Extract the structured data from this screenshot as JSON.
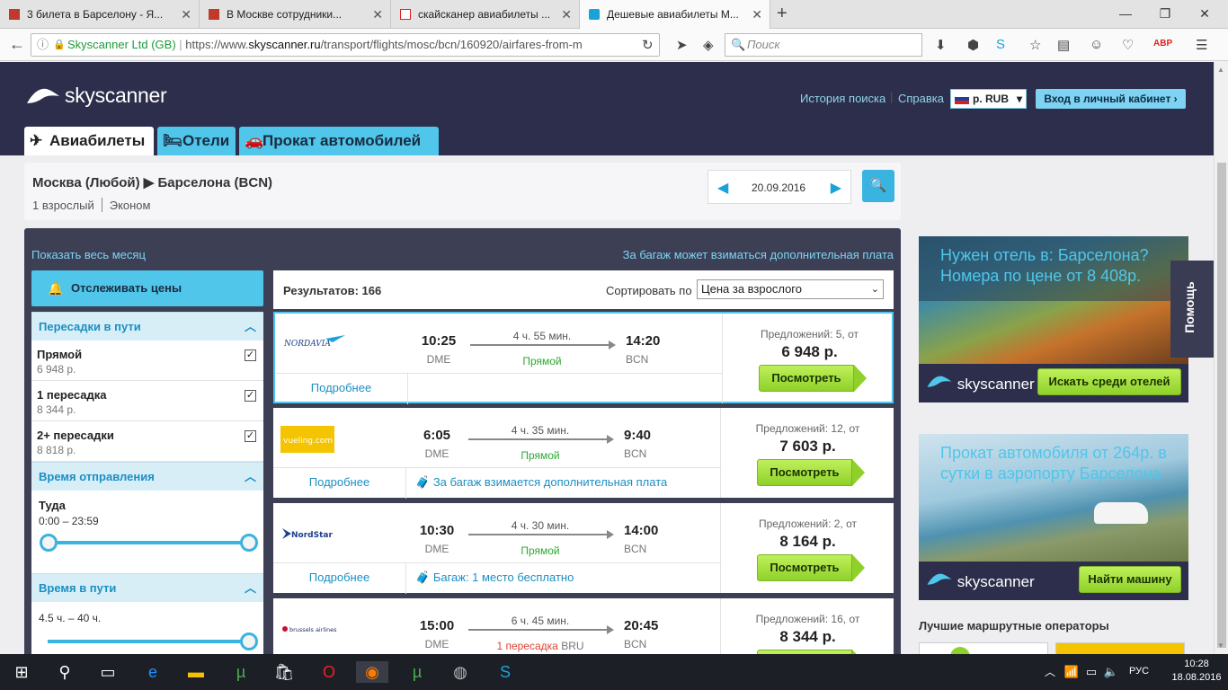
{
  "browser": {
    "tabs": [
      {
        "title": "3 билета в Барселону - Я...",
        "fav_color": "#c0392b"
      },
      {
        "title": "В Москве сотрудники...",
        "fav_color": "#c0392b"
      },
      {
        "title": "скайсканер авиабилеты ...",
        "fav_color": "#d22"
      },
      {
        "title": "Дешевые авиабилеты М...",
        "fav_color": "#1aa3d9"
      }
    ],
    "url_site": "Skyscanner Ltd (GB)",
    "url_prefix": "https://www.",
    "url_domain": "skyscanner.ru",
    "url_path": "/transport/flights/mosc/bcn/160920/airfares-from-m",
    "search_placeholder": "Поиск"
  },
  "header": {
    "logo_text": "skyscanner",
    "history_link": "История поиска",
    "help_link": "Справка",
    "currency": "р. RUB",
    "login": "Вход в личный кабинет"
  },
  "main_tabs": [
    {
      "label": "Авиабилеты",
      "icon": "plane-icon"
    },
    {
      "label": "Отели",
      "icon": "bed-icon"
    },
    {
      "label": "Прокат автомобилей",
      "icon": "car-icon"
    }
  ],
  "search": {
    "route_from": "Москва (Любой)",
    "route_to": "Барселона (BCN)",
    "passengers": "1 взрослый",
    "cabin": "Эконом",
    "date": "20.09.2016"
  },
  "results": {
    "show_month": "Показать весь месяц",
    "baggage_note": "За багаж может взиматься дополнительная плата",
    "track_prices": "Отслеживать цены",
    "count_label": "Результатов: 166",
    "sort_label": "Сортировать по",
    "sort_value": "Цена за взрослого"
  },
  "filters": {
    "stops_title": "Пересадки в пути",
    "stops": [
      {
        "name": "Прямой",
        "price": "6 948 р."
      },
      {
        "name": "1 пересадка",
        "price": "8 344 р."
      },
      {
        "name": "2+ пересадки",
        "price": "8 818 р."
      }
    ],
    "departure_title": "Время отправления",
    "departure_label": "Туда",
    "departure_range": "0:00 – 23:59",
    "duration_title": "Время в пути",
    "duration_range": "4.5 ч. – 40 ч."
  },
  "flights": [
    {
      "airline": "NORDAVIA",
      "dep": "10:25",
      "dep_code": "DME",
      "duration": "4 ч. 55 мин.",
      "stops": "Прямой",
      "arr": "14:20",
      "arr_code": "BCN",
      "offers": "Предложений: 5, от",
      "price": "6 948 р.",
      "bag": ""
    },
    {
      "airline": "vueling.com",
      "dep": "6:05",
      "dep_code": "DME",
      "duration": "4 ч. 35 мин.",
      "stops": "Прямой",
      "arr": "9:40",
      "arr_code": "BCN",
      "offers": "Предложений: 12, от",
      "price": "7 603 р.",
      "bag": "За багаж взимается дополнительная плата"
    },
    {
      "airline": "NordStar",
      "dep": "10:30",
      "dep_code": "DME",
      "duration": "4 ч. 30 мин.",
      "stops": "Прямой",
      "arr": "14:00",
      "arr_code": "BCN",
      "offers": "Предложений: 2, от",
      "price": "8 164 р.",
      "bag": "Багаж: 1 место бесплатно"
    },
    {
      "airline": "brussels airlines",
      "dep": "15:00",
      "dep_code": "DME",
      "duration": "6 ч. 45 мин.",
      "stops": "1 пересадка",
      "stops_via": "BRU",
      "arr": "20:45",
      "arr_code": "BCN",
      "offers": "Предложений: 16, от",
      "price": "8 344 р.",
      "bag": ""
    }
  ],
  "card_labels": {
    "more": "Подробнее",
    "view": "Посмотреть"
  },
  "ads": {
    "hotel_title": "Нужен отель в: Барселона? Номера по цене от 8 408р.",
    "hotel_button": "Искать среди отелей",
    "car_title": "Прокат автомобиля от 264р. в сутки в аэропорту Барселона",
    "car_button": "Найти машину",
    "operators_title": "Лучшие маршрутные операторы"
  },
  "help_tab": "Помощь",
  "taskbar": {
    "lang": "РУС",
    "time": "10:28",
    "date": "18.08.2016"
  },
  "colors": {
    "header_bg": "#2c2e4b",
    "accent": "#4fc6ea",
    "cta_green": "#8fd12a"
  }
}
